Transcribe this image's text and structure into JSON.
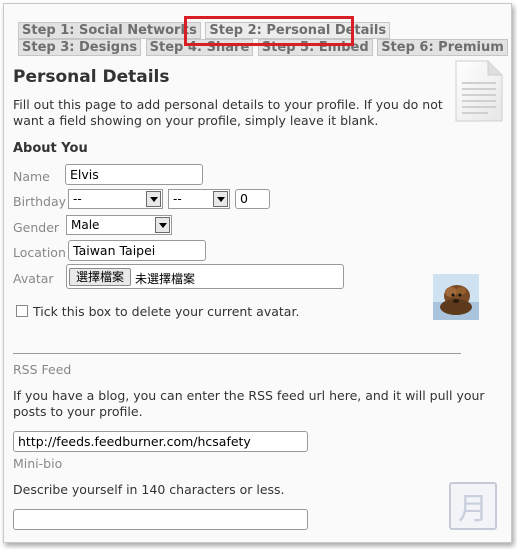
{
  "tabs": [
    {
      "label": "Step 1: Social Networks",
      "active": false
    },
    {
      "label": "Step 2: Personal Details",
      "active": true
    },
    {
      "label": "Step 3: Designs",
      "active": false
    },
    {
      "label": "Step 4: Share",
      "active": false
    },
    {
      "label": "Step 5: Embed",
      "active": false
    },
    {
      "label": "Step 6: Premium",
      "active": false
    }
  ],
  "page": {
    "title": "Personal Details",
    "intro": "Fill out this page to add personal details to your profile. If you do not want a field showing on your profile, simply leave it blank."
  },
  "about": {
    "heading": "About You",
    "name_label": "Name",
    "name_value": "Elvis",
    "birthday_label": "Birthday",
    "birthday_month": "--",
    "birthday_day": "--",
    "birthday_year": "0",
    "gender_label": "Gender",
    "gender_value": "Male",
    "location_label": "Location",
    "location_value": "Taiwan Taipei",
    "avatar_label": "Avatar",
    "file_button": "選擇檔案",
    "file_status": "未選擇檔案",
    "delete_avatar_label": "Tick this box to delete your current avatar."
  },
  "rss": {
    "heading": "RSS Feed",
    "description": "If you have a blog, you can enter the RSS feed url here, and it will pull your posts to your profile.",
    "url_value": "http://feeds.feedburner.com/hcsafety"
  },
  "minibio": {
    "heading": "Mini-bio",
    "description": "Describe yourself in 140 characters or less.",
    "value": ""
  },
  "icons": {
    "document": "document-icon",
    "avatar": "avatar-image",
    "calendar_char": "月"
  },
  "colors": {
    "highlight": "#d91f26",
    "tab_bg": "#e2e2e2"
  }
}
